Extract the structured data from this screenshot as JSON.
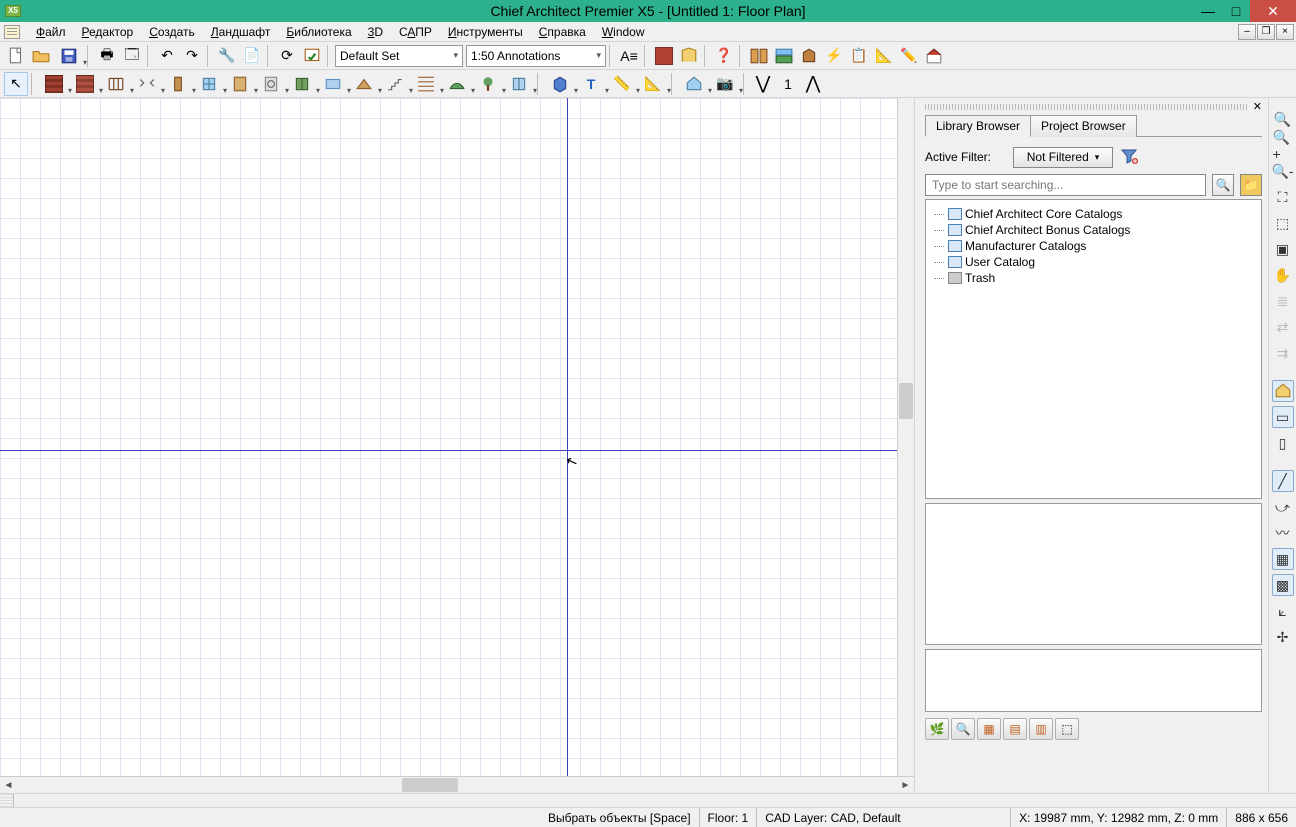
{
  "titlebar": {
    "icon_text": "X5",
    "title": "Chief Architect Premier X5 - [Untitled 1: Floor Plan]"
  },
  "menu": {
    "items": [
      "Файл",
      "Редактор",
      "Создать",
      "Ландшафт",
      "Библиотека",
      "3D",
      "САПР",
      "Инструменты",
      "Справка",
      "Window"
    ]
  },
  "toolbar1": {
    "default_set": "Default Set",
    "annotation_scale": "1:50 Annotations"
  },
  "toolbar2": {
    "floor_number": "1"
  },
  "panel": {
    "tab_library": "Library Browser",
    "tab_project": "Project Browser",
    "active_filter_label": "Active Filter:",
    "filter_value": "Not Filtered",
    "search_placeholder": "Type to start searching...",
    "tree": [
      "Chief Architect Core Catalogs",
      "Chief Architect Bonus Catalogs",
      "Manufacturer Catalogs",
      "User Catalog",
      "Trash"
    ]
  },
  "status": {
    "hint": "Выбрать объекты [Space]",
    "floor": "Floor: 1",
    "layer": "CAD Layer: CAD,  Default",
    "coords": "X: 19987 mm, Y: 12982 mm, Z: 0 mm",
    "dims": "886 x 656"
  }
}
